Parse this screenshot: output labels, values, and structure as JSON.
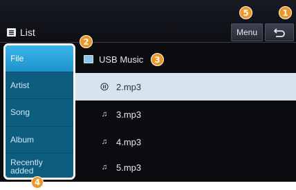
{
  "header": {
    "title": "List",
    "menu_label": "Menu",
    "back_icon": "back-arrow-icon"
  },
  "sidebar": {
    "items": [
      {
        "label": "File",
        "active": true
      },
      {
        "label": "Artist",
        "active": false
      },
      {
        "label": "Song",
        "active": false
      },
      {
        "label": "Album",
        "active": false
      },
      {
        "label": "Recently added",
        "active": false
      }
    ]
  },
  "content": {
    "folder": {
      "label": "USB Music",
      "icon": "folder-icon"
    },
    "tracks": [
      {
        "label": "2.mp3",
        "icon": "pause-icon",
        "playing": true
      },
      {
        "label": "3.mp3",
        "icon": "music-note-icon",
        "playing": false
      },
      {
        "label": "4.mp3",
        "icon": "music-note-icon",
        "playing": false
      },
      {
        "label": "5.mp3",
        "icon": "music-note-icon",
        "playing": false
      }
    ]
  },
  "callouts": [
    "1",
    "2",
    "3",
    "4",
    "5"
  ],
  "colors": {
    "accent": "#f29521",
    "sidebar_active": "#2aa3dc",
    "sidebar": "#0d5d80",
    "playing_row": "#d7e3ef"
  }
}
